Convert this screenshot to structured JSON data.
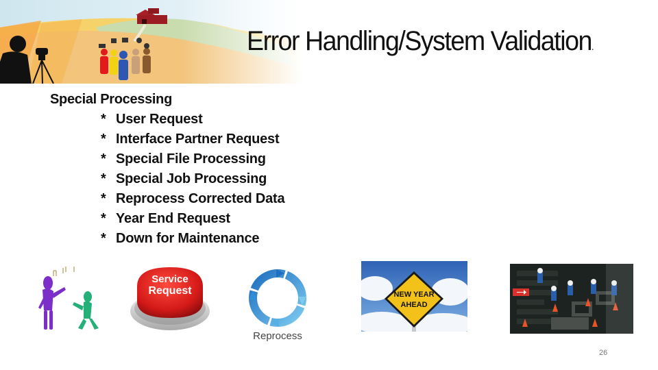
{
  "slide": {
    "title": "Error Handling/System Validation",
    "title_suffix": ".",
    "section_heading": "Special Processing",
    "bullet_marker": "*",
    "items": [
      "User Request",
      "Interface Partner Request",
      "Special File Processing",
      "Special Job Processing",
      "Reprocess Corrected Data",
      "Year End Request",
      "Down for Maintenance"
    ],
    "page_number": "26"
  },
  "images": {
    "banner": {
      "description": "farm landscape with barn, people figures and camera operator silhouette"
    },
    "cartoon": {
      "description": "purple and green cartoon figures with music notes"
    },
    "service_button": {
      "line1": "Service",
      "line2": "Request"
    },
    "reprocess": {
      "label": "Reprocess"
    },
    "new_year_sign": {
      "line1": "NEW YEAR",
      "line2": "AHEAD"
    },
    "circuit_board": {
      "description": "miniature workers on a circuit board"
    }
  },
  "colors": {
    "button_red": "#d81e1e",
    "reprocess_blue": "#2f8fd8",
    "sign_yellow": "#f2c21b",
    "sky_blue": "#3f7fc9"
  }
}
